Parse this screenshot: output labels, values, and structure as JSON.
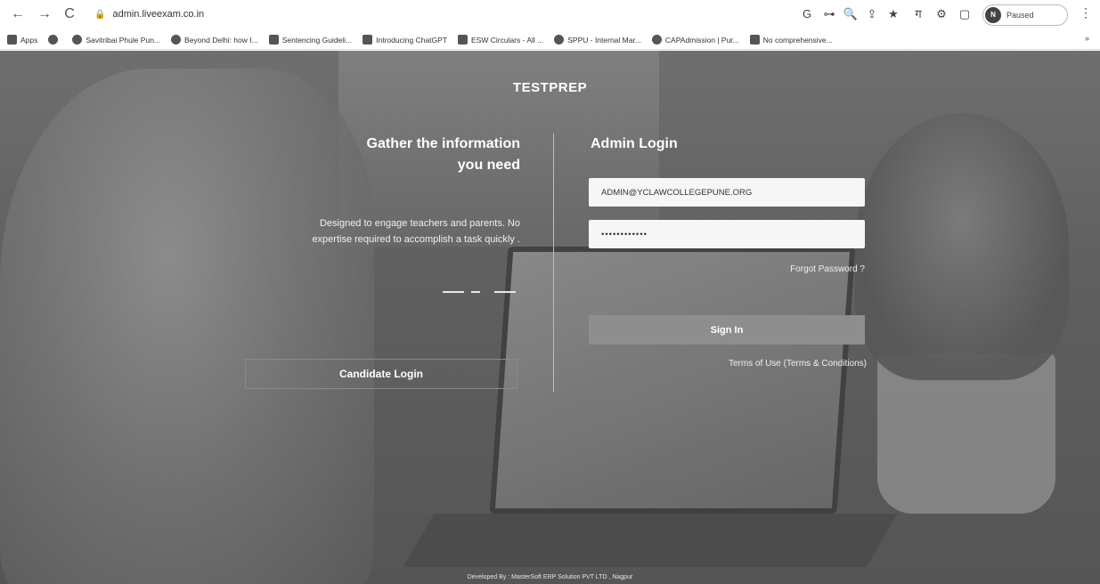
{
  "browser": {
    "url": "admin.liveexam.co.in",
    "profile_initial": "N",
    "profile_status": "Paused",
    "icons": {
      "back": "←",
      "forward": "→",
      "reload": "C",
      "lock": "🔒",
      "google": "G",
      "key": "⊶",
      "zoom": "🔍",
      "share": "⇪",
      "star": "★",
      "translate": "ग",
      "extensions": "⚙",
      "sidepanel": "▢",
      "menu": "⋮"
    }
  },
  "bookmarks": {
    "items": [
      {
        "label": "Apps"
      },
      {
        "label": ""
      },
      {
        "label": "Savitribai Phule Pun..."
      },
      {
        "label": "Beyond Delhi: how I..."
      },
      {
        "label": "Sentencing Guideli..."
      },
      {
        "label": "Introducing ChatGPT"
      },
      {
        "label": "ESW Circulars - All ..."
      },
      {
        "label": "SPPU - Internal Mar..."
      },
      {
        "label": "CAPAdmission | Pur..."
      },
      {
        "label": "No comprehensive..."
      }
    ],
    "more": "»"
  },
  "page": {
    "brand": "TESTPREP",
    "left": {
      "title_line1": "Gather the information",
      "title_line2": "you need",
      "description_line1": "Designed to engage teachers and parents. No",
      "description_line2": "expertise required to accomplish a task quickly .",
      "candidate_login": "Candidate Login"
    },
    "right": {
      "title": "Admin Login",
      "email_value": "ADMIN@YCLAWCOLLEGEPUNE.ORG",
      "password_value": "••••••••••••",
      "forgot_password": "Forgot Password ?",
      "sign_in": "Sign In",
      "terms": "Terms of Use (Terms & Conditions)"
    },
    "footer": "Developed By : MasterSoft ERP Solution PVT LTD , Nagpur"
  }
}
